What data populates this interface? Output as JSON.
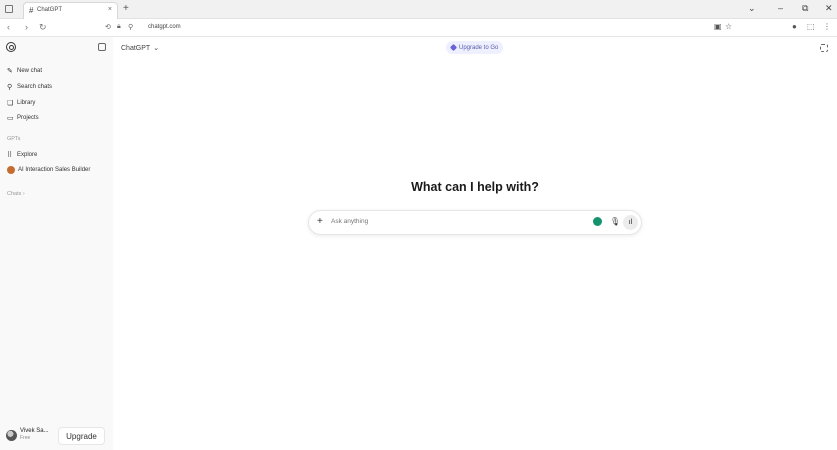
{
  "browser": {
    "tab_title": "ChatGPT",
    "tab_favicon": "#",
    "close_glyph": "×",
    "new_tab_glyph": "+",
    "url_prefix": "⚲",
    "url": "chatgpt.com",
    "window_controls": [
      "⌄",
      "–",
      "⧉",
      "✕"
    ]
  },
  "sidebar": {
    "items": [
      {
        "label": "New chat",
        "icon": "edit-icon",
        "glyph": "✎"
      },
      {
        "label": "Search chats",
        "icon": "search-icon",
        "glyph": "⚲"
      },
      {
        "label": "Library",
        "icon": "library-icon",
        "glyph": "❏"
      },
      {
        "label": "Projects",
        "icon": "folder-icon",
        "glyph": "▭"
      }
    ],
    "gpts_section": "GPTs",
    "gpts": [
      {
        "label": "Explore",
        "icon": "grid-icon",
        "glyph": "⠿"
      },
      {
        "label": "AI Interaction Sales Builder",
        "icon": "gpt-avatar-icon"
      }
    ],
    "chats_section": "Chats ›",
    "user": {
      "name": "Vivek Sa...",
      "plan": "Free"
    },
    "upgrade_label": "Upgrade"
  },
  "main": {
    "model_name": "ChatGPT",
    "model_chevron": "⌄",
    "upgrade_pill": "Upgrade to Go",
    "headline": "What can I help with?",
    "composer": {
      "placeholder": "Ask anything",
      "plus_glyph": "+",
      "mic_glyph": "🎙",
      "voice_glyph": "ıl"
    }
  }
}
